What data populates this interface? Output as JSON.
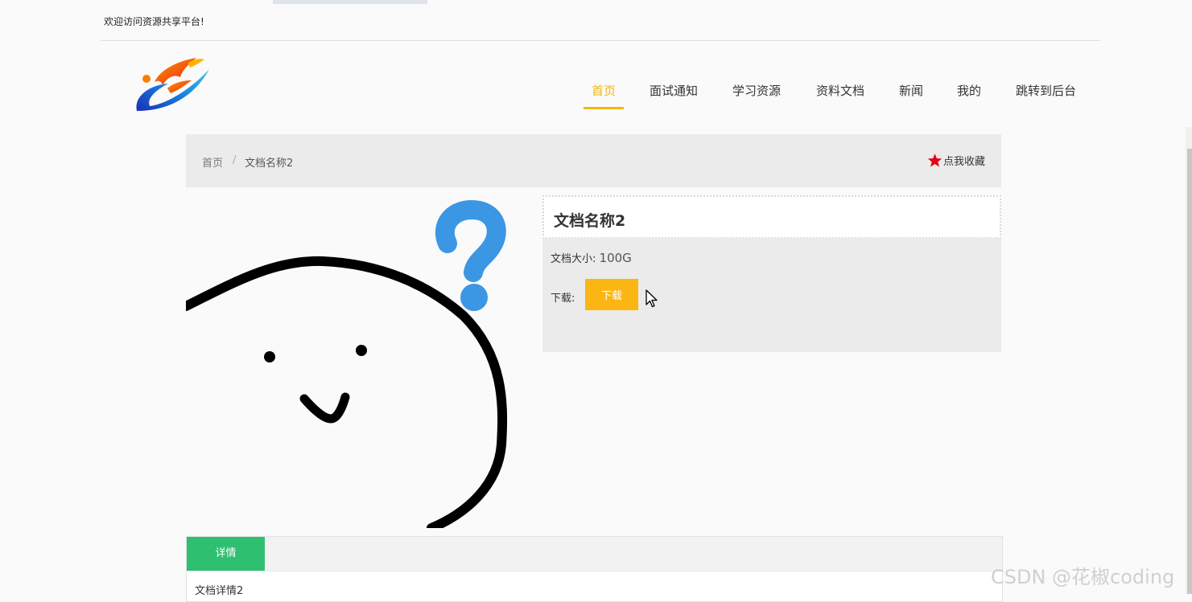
{
  "header": {
    "welcome": "欢迎访问资源共享平台!"
  },
  "nav": {
    "items": [
      {
        "label": "首页",
        "active": true
      },
      {
        "label": "面试通知"
      },
      {
        "label": "学习资源"
      },
      {
        "label": "资料文档"
      },
      {
        "label": "新闻"
      },
      {
        "label": "我的"
      },
      {
        "label": "跳转到后台"
      }
    ]
  },
  "breadcrumb": {
    "home": "首页",
    "separator": "/",
    "current": "文档名称2",
    "favorite_label": "点我收藏"
  },
  "document": {
    "title": "文档名称2",
    "size_label": "文档大小:",
    "size_value": "100G",
    "download_label": "下载:",
    "download_button": "下载"
  },
  "detail": {
    "tab_label": "详情",
    "text": "文档详情2"
  },
  "watermark": "CSDN @花椒coding",
  "colors": {
    "accent": "#f5b80e",
    "download_button": "#fcb613",
    "tab_active": "#2fbf71",
    "star": "#e60012"
  }
}
